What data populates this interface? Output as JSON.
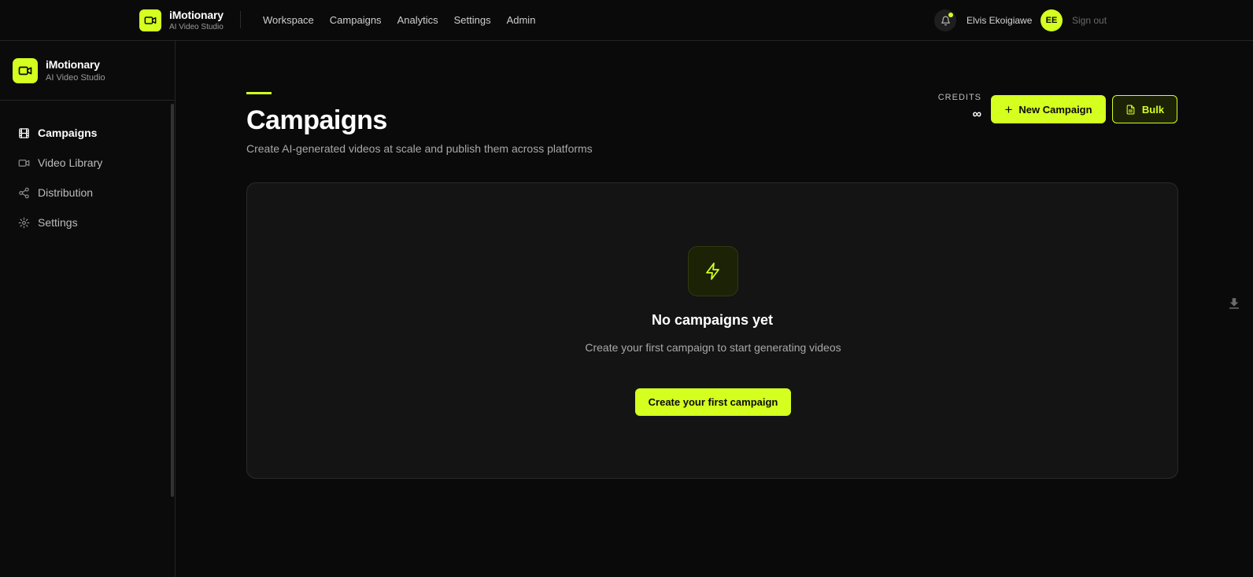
{
  "app": {
    "name": "iMotionary",
    "tagline": "AI Video Studio"
  },
  "topnav": {
    "items": [
      "Workspace",
      "Campaigns",
      "Analytics",
      "Settings",
      "Admin"
    ],
    "user_name": "Elvis Ekoigiawe",
    "user_initials": "EE",
    "sign_out": "Sign out"
  },
  "sidebar": {
    "items": [
      {
        "label": "Campaigns",
        "icon": "film-icon",
        "active": true
      },
      {
        "label": "Video Library",
        "icon": "video-icon",
        "active": false
      },
      {
        "label": "Distribution",
        "icon": "share-icon",
        "active": false
      },
      {
        "label": "Settings",
        "icon": "gear-icon",
        "active": false
      }
    ]
  },
  "header": {
    "title": "Campaigns",
    "subtitle": "Create AI-generated videos at scale and publish them across platforms",
    "credits_label": "CREDITS",
    "credits_value": "∞",
    "new_campaign": "New Campaign",
    "bulk": "Bulk"
  },
  "empty_state": {
    "title": "No campaigns yet",
    "description": "Create your first campaign to start generating videos",
    "cta": "Create your first campaign"
  },
  "colors": {
    "accent": "#d4ff1f",
    "background": "#0a0a0a",
    "card": "#141414"
  }
}
